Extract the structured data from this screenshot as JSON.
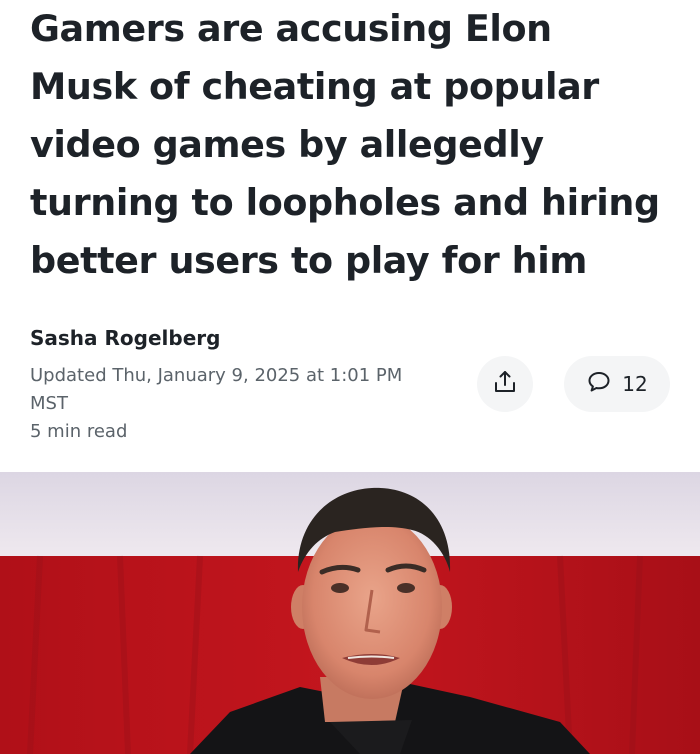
{
  "article": {
    "headline_lines": [
      "Gamers are accusing Elon",
      "Musk of cheating at popular",
      "video games by allegedly",
      "turning to loopholes and hiring",
      "better users to play for him"
    ],
    "author": "Sasha Rogelberg",
    "updated_line1": "Updated Thu, January 9, 2025 at 1:01 PM",
    "updated_line2": "MST",
    "read_time": "5 min read"
  },
  "actions": {
    "share_icon": "share-upload-icon",
    "comment_icon": "speech-bubble-icon",
    "comment_count": "12"
  },
  "colors": {
    "text_primary": "#1d2228",
    "text_secondary": "#5b636a",
    "button_bg": "#f4f5f6",
    "photo_background_red": "#b8141c",
    "photo_background_white": "#e6e1e8"
  }
}
